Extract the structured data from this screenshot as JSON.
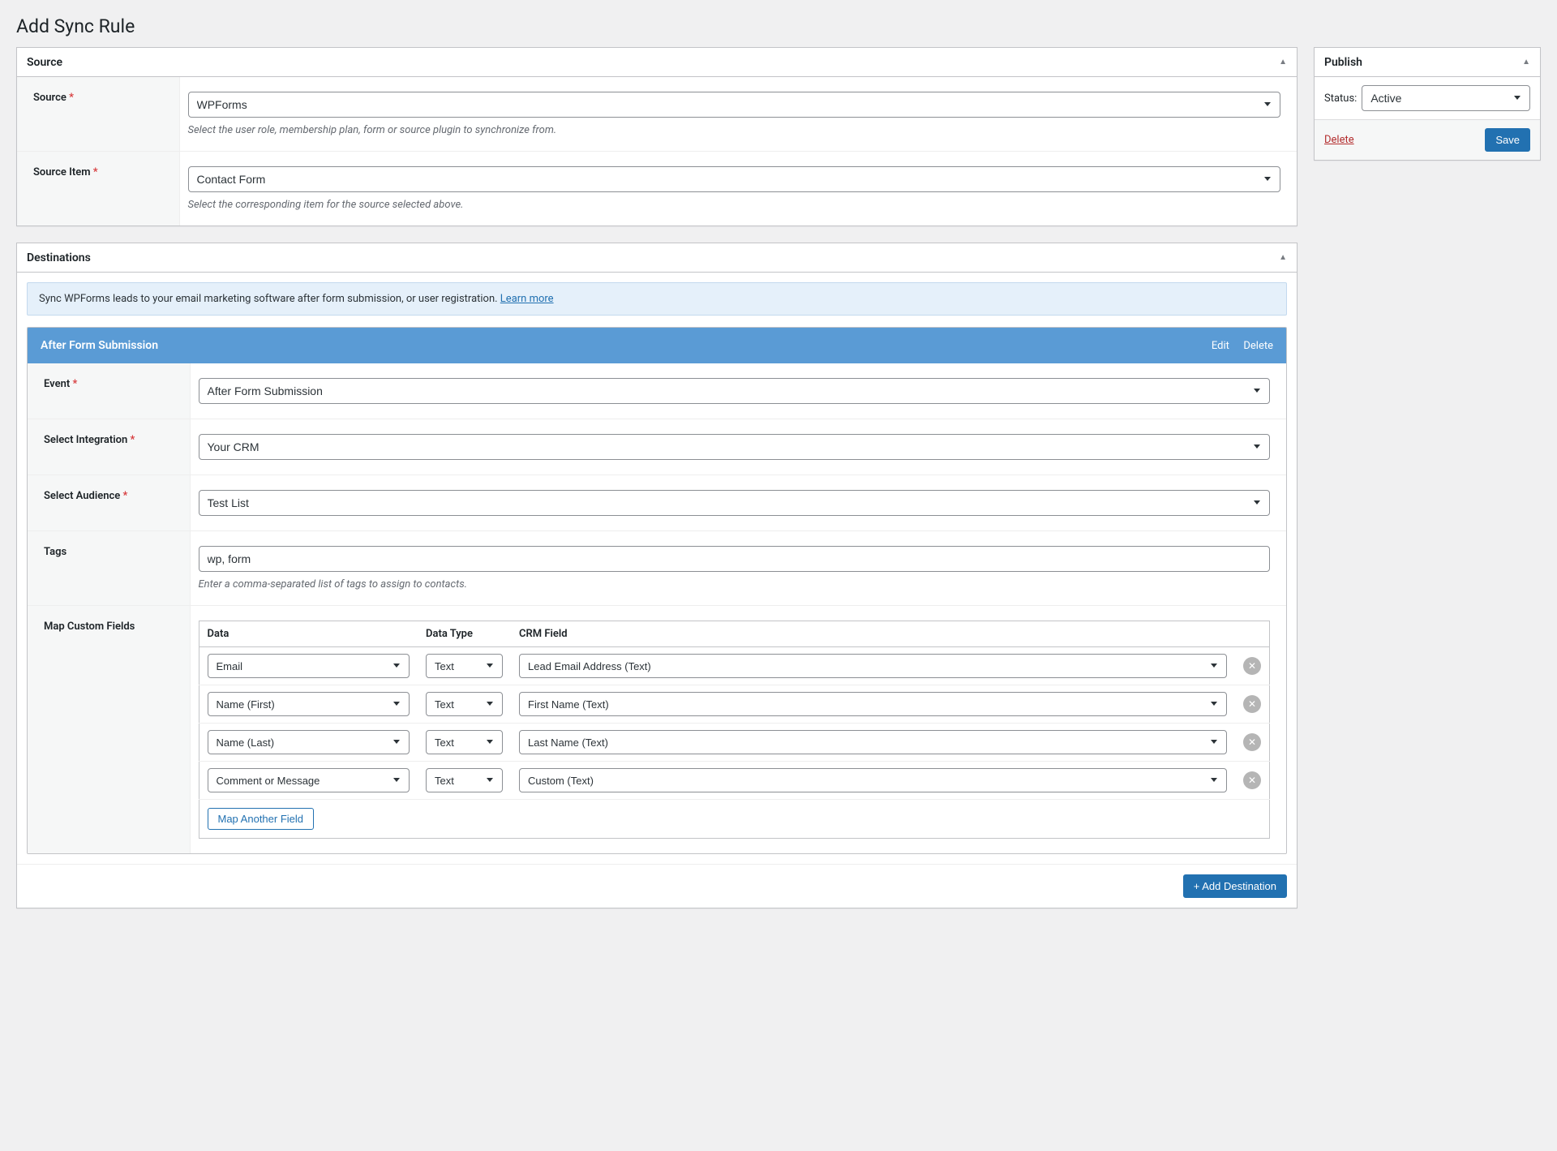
{
  "page": {
    "title": "Add Sync Rule"
  },
  "source_panel": {
    "heading": "Source",
    "source_label": "Source",
    "source_value": "WPForms",
    "source_desc": "Select the user role, membership plan, form or source plugin to synchronize from.",
    "item_label": "Source Item",
    "item_value": "Contact Form",
    "item_desc": "Select the corresponding item for the source selected above."
  },
  "dest_panel": {
    "heading": "Destinations",
    "notice_text": "Sync WPForms leads to your email marketing software after form submission, or user registration. ",
    "notice_link": "Learn more",
    "block_title": "After Form Submission",
    "edit_label": "Edit",
    "delete_label": "Delete",
    "event_label": "Event",
    "event_value": "After Form Submission",
    "integration_label": "Select Integration",
    "integration_value": "Your CRM",
    "audience_label": "Select Audience",
    "audience_value": "Test List",
    "tags_label": "Tags",
    "tags_value": "wp, form",
    "tags_desc": "Enter a comma-separated list of tags to assign to contacts.",
    "map_label": "Map Custom Fields",
    "map_headers": {
      "data": "Data",
      "type": "Data Type",
      "crm": "CRM Field"
    },
    "map_rows": [
      {
        "data": "Email",
        "type": "Text",
        "crm": "Lead Email Address (Text)"
      },
      {
        "data": "Name (First)",
        "type": "Text",
        "crm": "First Name (Text)"
      },
      {
        "data": "Name (Last)",
        "type": "Text",
        "crm": "Last Name (Text)"
      },
      {
        "data": "Comment or Message",
        "type": "Text",
        "crm": "Custom (Text)"
      }
    ],
    "map_another": "Map Another Field",
    "add_destination": "+ Add Destination"
  },
  "publish_panel": {
    "heading": "Publish",
    "status_label": "Status:",
    "status_value": "Active",
    "delete_label": "Delete",
    "save_label": "Save"
  }
}
